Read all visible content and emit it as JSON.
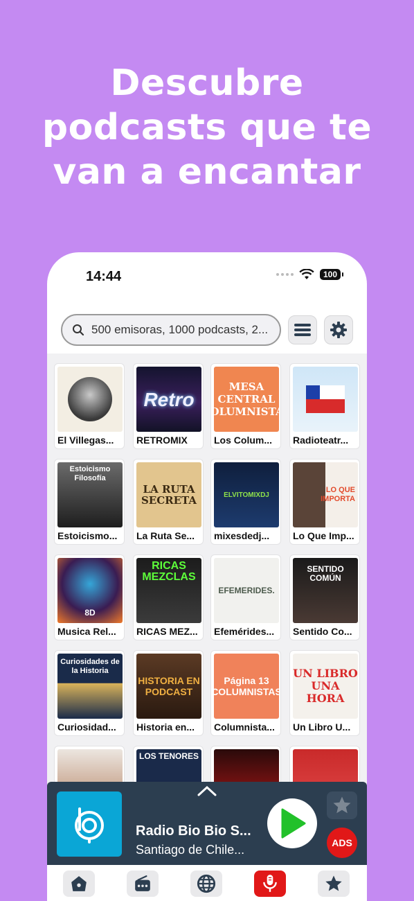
{
  "headline": [
    "Descubre",
    "podcasts que te",
    "van a encantar"
  ],
  "status": {
    "time": "14:44",
    "battery": "100"
  },
  "search": {
    "placeholder": "500 emisoras, 1000 podcasts, 2..."
  },
  "podcasts": [
    {
      "label": "El Villegas...",
      "art_text": ""
    },
    {
      "label": "RETROMIX",
      "art_text": "Retro"
    },
    {
      "label": "Los Colum...",
      "art_text": "MESA CENTRAL COLUMNISTAS"
    },
    {
      "label": "Radioteatr...",
      "art_text": ""
    },
    {
      "label": "Estoicismo...",
      "art_text": "Estoicismo Filosofía"
    },
    {
      "label": "La Ruta Se...",
      "art_text": "LA RUTA SECRETA"
    },
    {
      "label": "mixesdedj...",
      "art_text": "ELVITOMIXDJ"
    },
    {
      "label": "Lo Que Imp...",
      "art_text": "LO QUE IMPORTA"
    },
    {
      "label": "Musica Rel...",
      "art_text": "8D"
    },
    {
      "label": "RICAS MEZ...",
      "art_text": "RICAS MEZCLAS"
    },
    {
      "label": "Efemérides...",
      "art_text": "EFEMERIDES."
    },
    {
      "label": "Sentido Co...",
      "art_text": "SENTIDO COMÚN"
    },
    {
      "label": "Curiosidad...",
      "art_text": "Curiosidades de la Historia"
    },
    {
      "label": "Historia en...",
      "art_text": "HISTORIA EN PODCAST"
    },
    {
      "label": "Columnista...",
      "art_text": "Página 13 COLUMNISTAS"
    },
    {
      "label": "Un Libro U...",
      "art_text": "UN LIBRO UNA HORA"
    },
    {
      "label": "",
      "art_text": ""
    },
    {
      "label": "",
      "art_text": "LOS TENORES"
    },
    {
      "label": "",
      "art_text": ""
    },
    {
      "label": "",
      "art_text": ""
    }
  ],
  "player": {
    "title": "Radio Bio Bio S...",
    "subtitle": "Santiago de Chile...",
    "ads_label": "ADS"
  },
  "tabs": [
    {
      "icon": "home-icon"
    },
    {
      "icon": "radio-icon"
    },
    {
      "icon": "globe-icon"
    },
    {
      "icon": "microphone-icon",
      "active": true
    },
    {
      "icon": "star-icon"
    }
  ],
  "colors": {
    "background": "#c48af2",
    "player": "#2c3e50",
    "accent": "#e11818",
    "play": "#22c12a"
  }
}
